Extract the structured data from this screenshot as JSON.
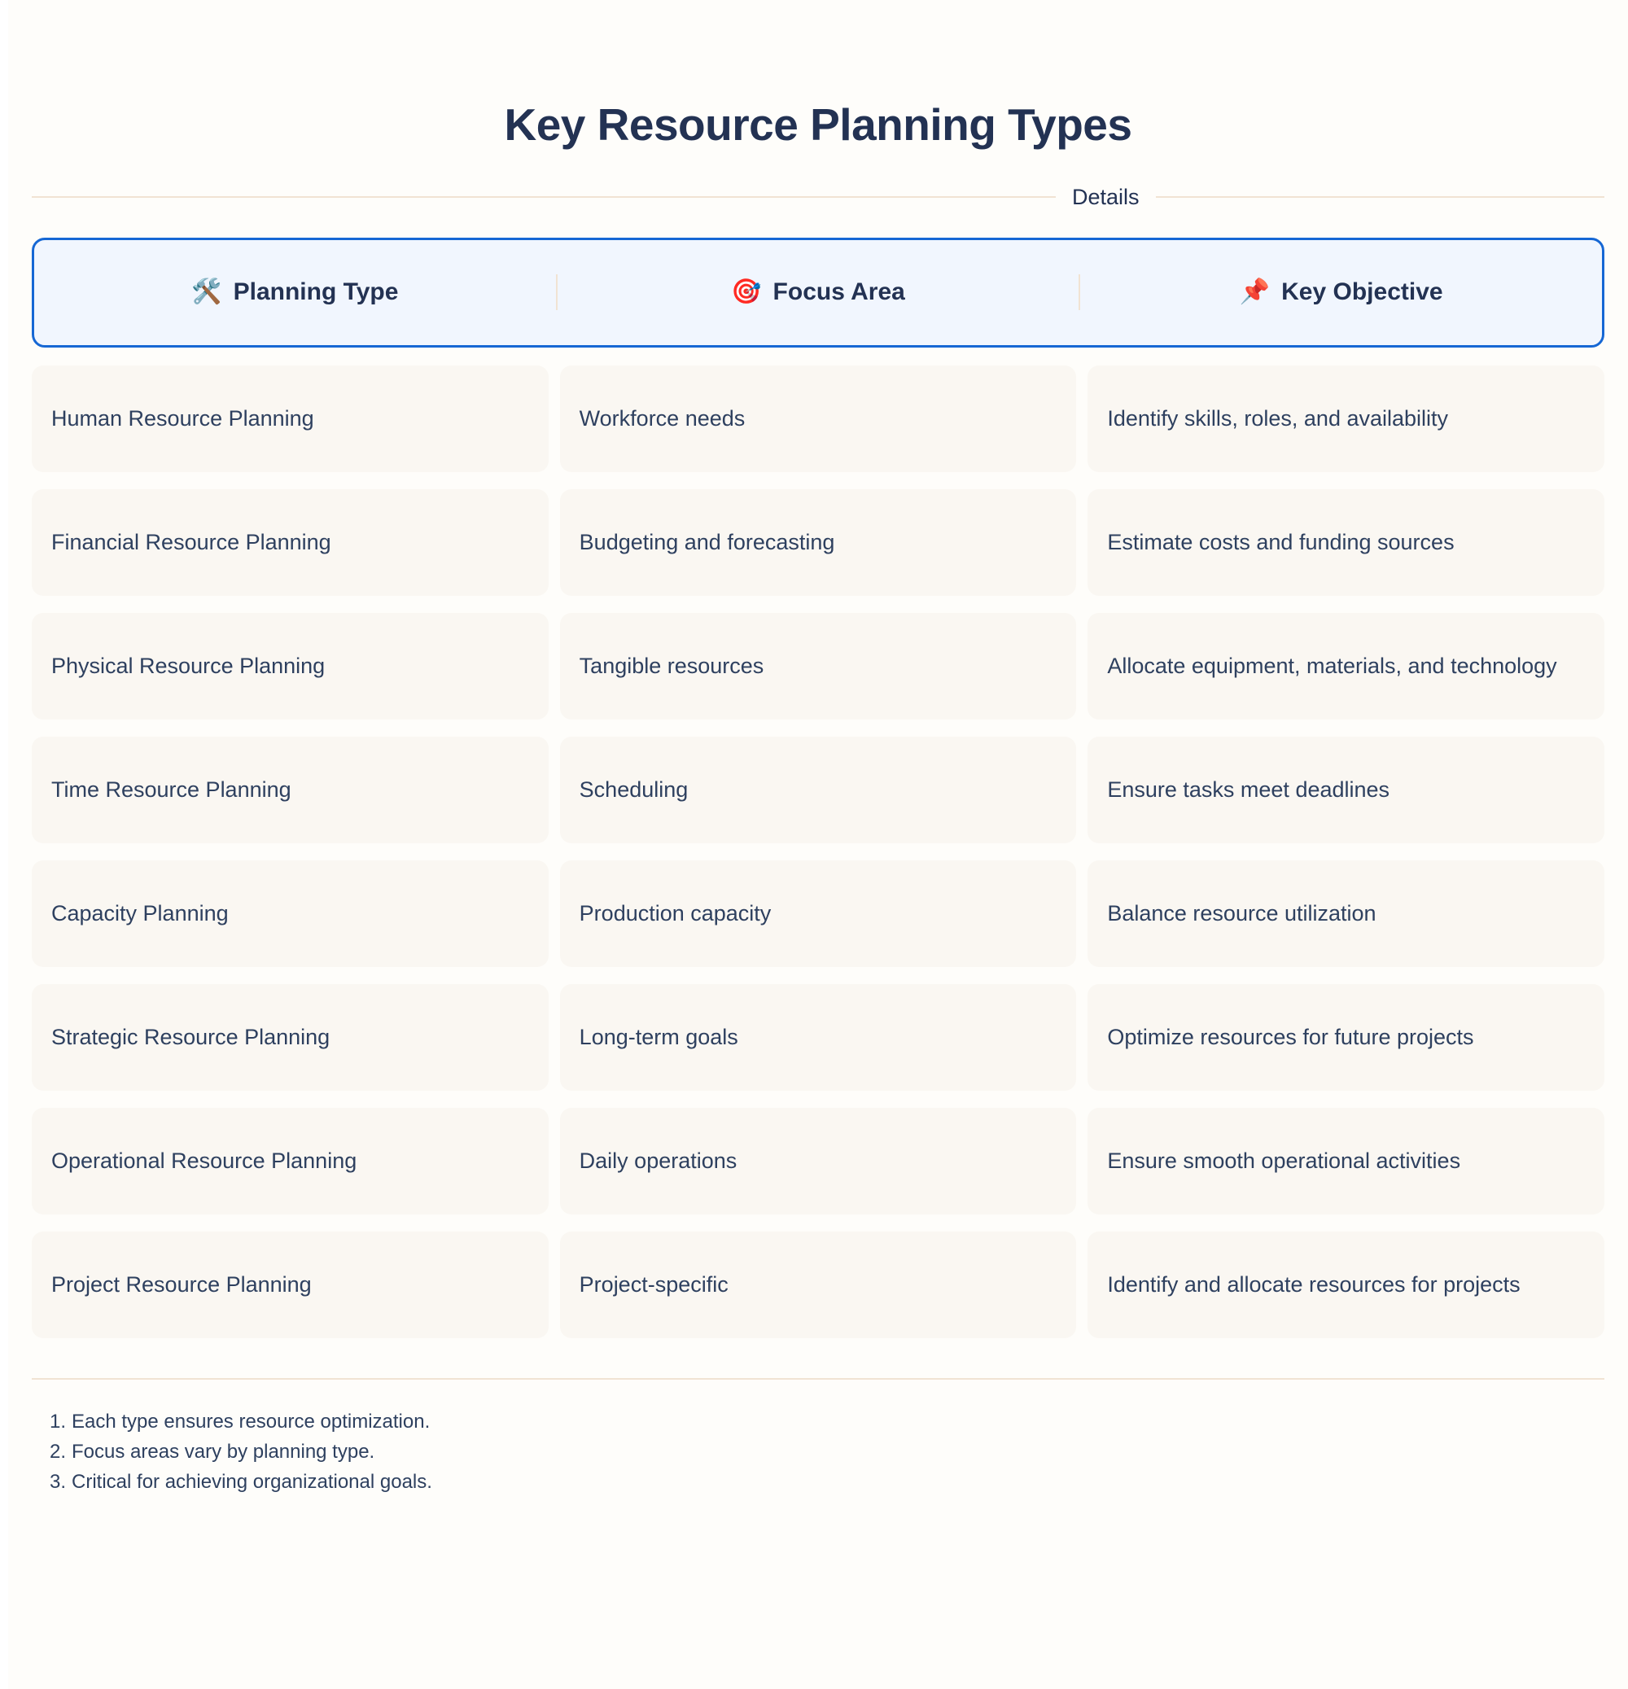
{
  "page": {
    "title": "Key Resource Planning Types",
    "section_label": "Details",
    "background_color": "#fefdfa",
    "title_color": "#233253",
    "accent_color": "#1667d4",
    "cell_color": "#faf7f2",
    "divider_color": "#f1e3d3"
  },
  "table": {
    "columns": [
      {
        "label": "Planning Type",
        "icon": "🛠️",
        "icon_name": "hammer-and-wrench-icon"
      },
      {
        "label": "Focus Area",
        "icon": "🎯",
        "icon_name": "target-icon"
      },
      {
        "label": "Key Objective",
        "icon": "📌",
        "icon_name": "pushpin-icon"
      }
    ],
    "rows": [
      {
        "planning_type": "Human Resource Planning",
        "focus_area": "Workforce needs",
        "key_objective": "Identify skills, roles, and availability"
      },
      {
        "planning_type": "Financial Resource Planning",
        "focus_area": "Budgeting and forecasting",
        "key_objective": "Estimate costs and funding sources"
      },
      {
        "planning_type": "Physical Resource Planning",
        "focus_area": "Tangible resources",
        "key_objective": "Allocate equipment, materials, and technology"
      },
      {
        "planning_type": "Time Resource Planning",
        "focus_area": "Scheduling",
        "key_objective": "Ensure tasks meet deadlines"
      },
      {
        "planning_type": "Capacity Planning",
        "focus_area": "Production capacity",
        "key_objective": "Balance resource utilization"
      },
      {
        "planning_type": "Strategic Resource Planning",
        "focus_area": "Long-term goals",
        "key_objective": "Optimize resources for future projects"
      },
      {
        "planning_type": "Operational Resource Planning",
        "focus_area": "Daily operations",
        "key_objective": "Ensure smooth operational activities"
      },
      {
        "planning_type": "Project Resource Planning",
        "focus_area": "Project-specific",
        "key_objective": "Identify and allocate resources for projects"
      }
    ]
  },
  "footer": {
    "notes": [
      {
        "number": "1.",
        "text": "Each type ensures resource optimization."
      },
      {
        "number": "2.",
        "text": "Focus areas vary by planning type."
      },
      {
        "number": "3.",
        "text": "Critical for achieving organizational goals."
      }
    ]
  }
}
